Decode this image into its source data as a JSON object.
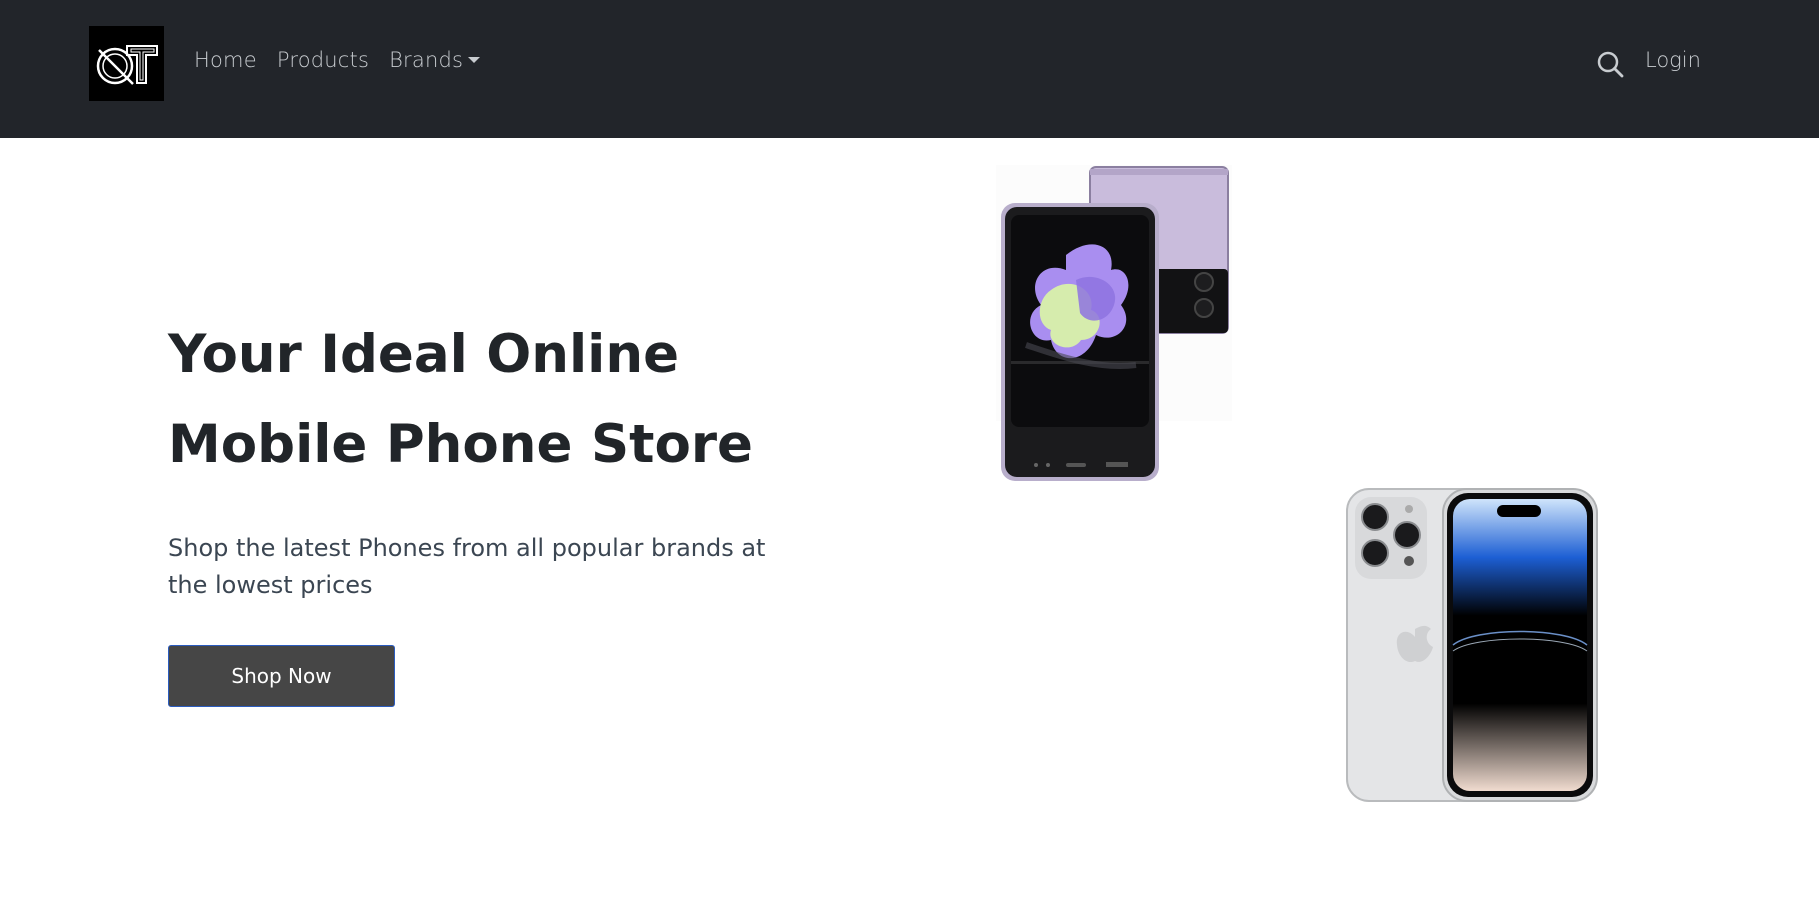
{
  "nav": {
    "logo_alt": "QT",
    "links": [
      {
        "label": "Home"
      },
      {
        "label": "Products"
      },
      {
        "label": "Brands"
      }
    ],
    "login_label": "Login",
    "search_icon": "search-icon",
    "brands_icon": "caret-down-icon"
  },
  "hero": {
    "title_line1": "Your Ideal Online",
    "title_line2": "Mobile Phone Store",
    "subtitle": "Shop the latest Phones from all popular brands at the lowest prices",
    "cta_label": "Shop Now"
  },
  "images": {
    "phone1": "foldable-phone-image",
    "phone2": "smartphone-image"
  },
  "colors": {
    "navbar_bg": "#22252a",
    "button_bg": "#464646",
    "button_border": "#2b5cbf",
    "title": "#212529",
    "subtitle": "#3b4652"
  }
}
